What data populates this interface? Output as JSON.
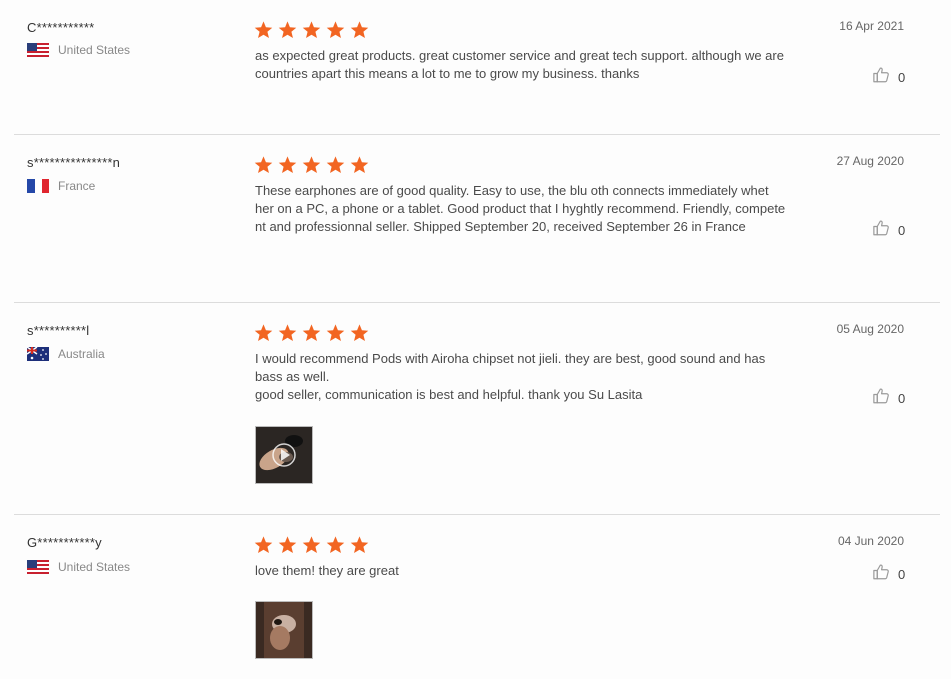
{
  "colors": {
    "star": "#f26522",
    "divider": "#dcdcdc"
  },
  "reviews": [
    {
      "user": "C***********",
      "country": "United States",
      "flag": "us-flag-icon",
      "rating": 5,
      "date": "16 Apr 2021",
      "lines": [
        "as expected great products. great customer service and great tech support. although we are",
        "countries apart this means a lot to me to grow  my business. thanks"
      ],
      "likes": "0"
    },
    {
      "user": "s***************n",
      "country": "France",
      "flag": "france-flag-icon",
      "rating": 5,
      "date": "27 Aug 2020",
      "lines": [
        "These earphones are of good quality. Easy to use, the blu      oth connects immediately whet",
        "her on a PC, a phone or a tablet. Good product that I hyghtly recommend. Friendly, compete",
        "nt and professionnal seller. Shipped September 20, received September 26 in France"
      ],
      "likes": "0"
    },
    {
      "user": "s**********l",
      "country": "Australia",
      "flag": "australia-flag-icon",
      "rating": 5,
      "date": "05 Aug 2020",
      "lines": [
        "I would recommend     Pods with Airoha chipset not jieli. they are best, good sound and has",
        "bass as well.",
        "good seller, communication is best and helpful.  thank you Su Lasita"
      ],
      "likes": "0",
      "photo": "video-thumbnail"
    },
    {
      "user": "G***********y",
      "country": "United States",
      "flag": "us-flag-icon",
      "rating": 5,
      "date": "04 Jun 2020",
      "lines": [
        "love them! they are great"
      ],
      "likes": "0",
      "photo": "photo-thumbnail"
    }
  ]
}
